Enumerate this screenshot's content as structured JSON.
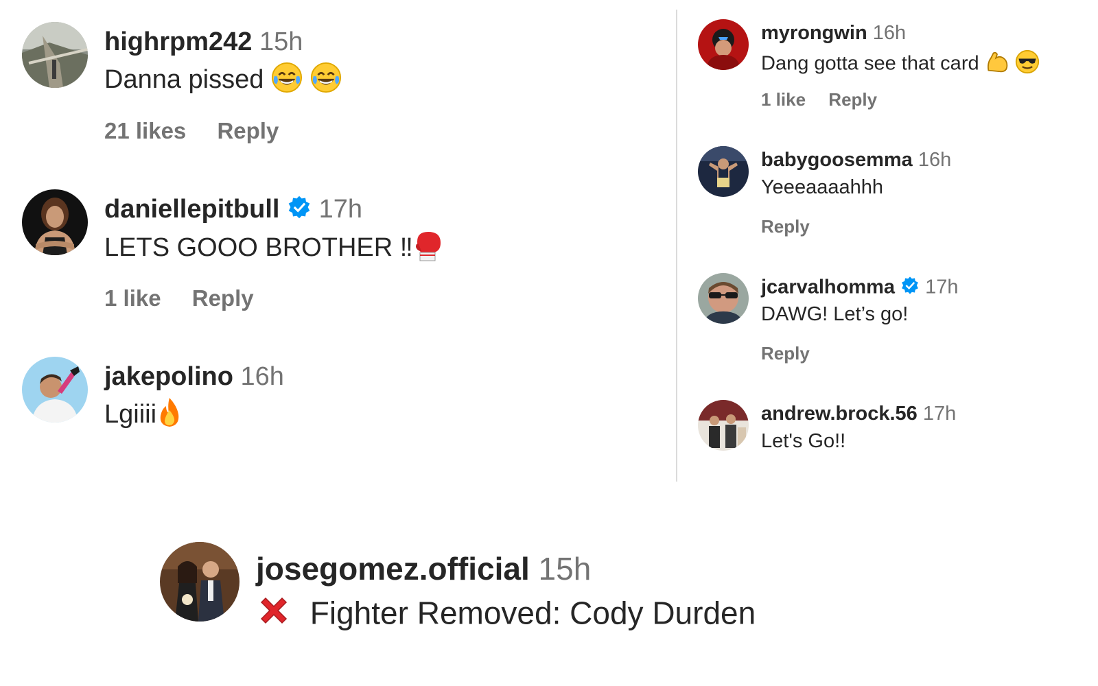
{
  "left_comments": [
    {
      "username": "highrpm242",
      "time": "15h",
      "text": "Danna pissed",
      "likes": "21 likes",
      "reply": "Reply",
      "emoji": [
        "tears-of-joy-icon",
        "tears-of-joy-icon"
      ]
    },
    {
      "username": "daniellepitbull",
      "verified": true,
      "time": "17h",
      "text": "LETS GOOO BROTHER ‼",
      "likes": "1 like",
      "reply": "Reply",
      "emoji": [
        "boxing-glove-icon"
      ]
    },
    {
      "username": "jakepolino",
      "time": "16h",
      "text": "Lgiiii",
      "emoji": [
        "fire-icon"
      ]
    }
  ],
  "right_comments": [
    {
      "username": "myrongwin",
      "time": "16h",
      "text": "Dang gotta see that card",
      "likes": "1 like",
      "reply": "Reply",
      "emoji": [
        "flexed-biceps-icon",
        "sunglasses-face-icon"
      ]
    },
    {
      "username": "babygoosemma",
      "time": "16h",
      "text": "Yeeeaaaahhh",
      "reply": "Reply"
    },
    {
      "username": "jcarvalhomma",
      "verified": true,
      "time": "17h",
      "text": "DAWG! Let’s go!",
      "reply": "Reply"
    },
    {
      "username": "andrew.brock.56",
      "time": "17h",
      "text": "Let's Go!!"
    }
  ],
  "bottom_comment": {
    "username": "josegomez.official",
    "time": "15h",
    "text": "Fighter Removed: Cody Durden",
    "emoji": [
      "cross-mark-icon"
    ]
  },
  "colors": {
    "text": "#262626",
    "muted": "#737373",
    "verified": "#0095f6",
    "divider": "#dbdbdb"
  }
}
